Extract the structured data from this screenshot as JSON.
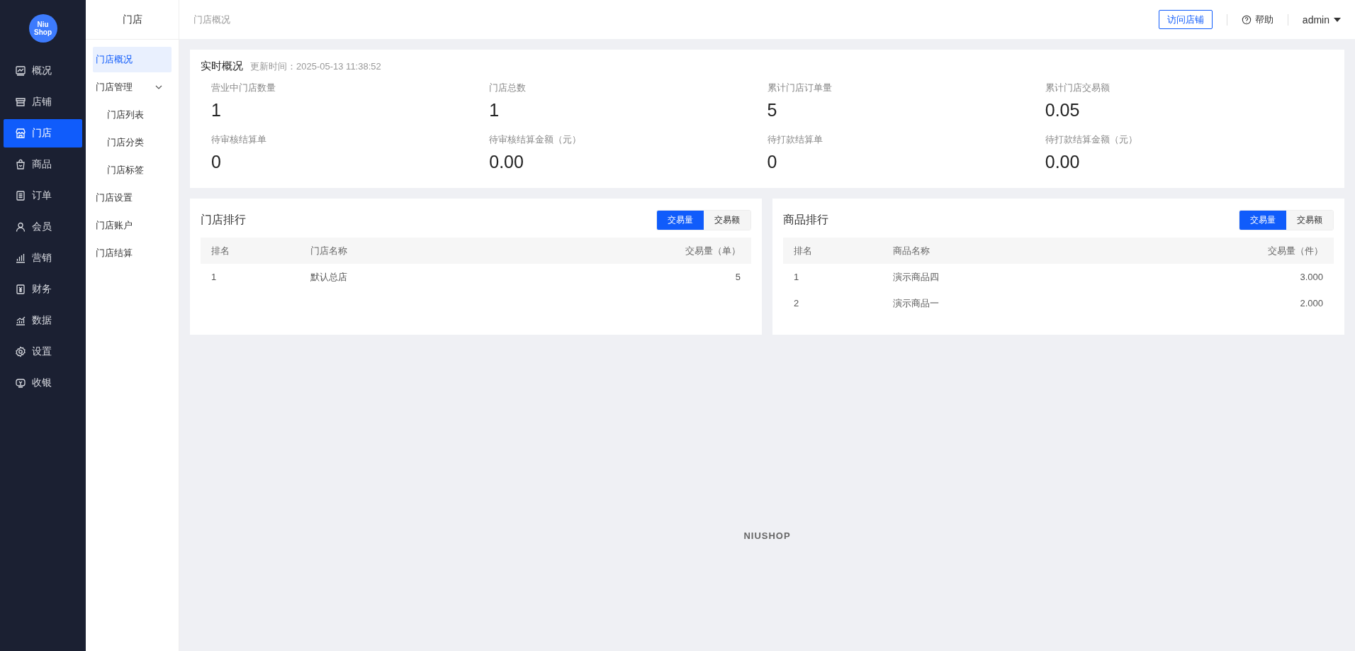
{
  "logo": {
    "lines": [
      "Niu",
      "Shop"
    ]
  },
  "sidebar": {
    "items": [
      {
        "label": "概况",
        "selected": false
      },
      {
        "label": "店铺",
        "selected": false
      },
      {
        "label": "门店",
        "selected": true
      },
      {
        "label": "商品",
        "selected": false
      },
      {
        "label": "订单",
        "selected": false
      },
      {
        "label": "会员",
        "selected": false
      },
      {
        "label": "营销",
        "selected": false
      },
      {
        "label": "财务",
        "selected": false
      },
      {
        "label": "数据",
        "selected": false
      },
      {
        "label": "设置",
        "selected": false
      },
      {
        "label": "收银",
        "selected": false
      }
    ]
  },
  "subnav": {
    "title": "门店",
    "items": [
      {
        "label": "门店概况",
        "selected": true
      },
      {
        "label": "门店管理",
        "selected": false,
        "expanded": true,
        "children": [
          {
            "label": "门店列表",
            "selected": false
          },
          {
            "label": "门店分类",
            "selected": false
          },
          {
            "label": "门店标签",
            "selected": false
          }
        ]
      },
      {
        "label": "门店设置",
        "selected": false
      },
      {
        "label": "门店账户",
        "selected": false
      },
      {
        "label": "门店结算",
        "selected": false
      }
    ]
  },
  "topbar": {
    "breadcrumb": "门店概况",
    "visit_button": "访问店铺",
    "help": "帮助",
    "user": "admin"
  },
  "overview": {
    "title": "实时概况",
    "updated": "更新时间：2025-05-13 11:38:52",
    "stats": [
      {
        "label": "营业中门店数量",
        "value": "1"
      },
      {
        "label": "门店总数",
        "value": "1"
      },
      {
        "label": "累计门店订单量",
        "value": "5"
      },
      {
        "label": "累计门店交易额",
        "value": "0.05"
      },
      {
        "label": "待审核结算单",
        "value": "0"
      },
      {
        "label": "待审核结算金额（元）",
        "value": "0.00"
      },
      {
        "label": "待打款结算单",
        "value": "0"
      },
      {
        "label": "待打款结算金额（元）",
        "value": "0.00"
      }
    ]
  },
  "rankings": [
    {
      "title": "门店排行",
      "toggles": [
        {
          "label": "交易量",
          "selected": true
        },
        {
          "label": "交易额",
          "selected": false
        }
      ],
      "columns": [
        "排名",
        "门店名称",
        "交易量（单）"
      ],
      "rows": [
        [
          "1",
          "默认总店",
          "5"
        ]
      ]
    },
    {
      "title": "商品排行",
      "toggles": [
        {
          "label": "交易量",
          "selected": true
        },
        {
          "label": "交易额",
          "selected": false
        }
      ],
      "columns": [
        "排名",
        "商品名称",
        "交易量（件）"
      ],
      "rows": [
        [
          "1",
          "演示商品四",
          "3.000"
        ],
        [
          "2",
          "演示商品一",
          "2.000"
        ]
      ]
    }
  ],
  "footer": {
    "brand": "NIUSHOP"
  }
}
